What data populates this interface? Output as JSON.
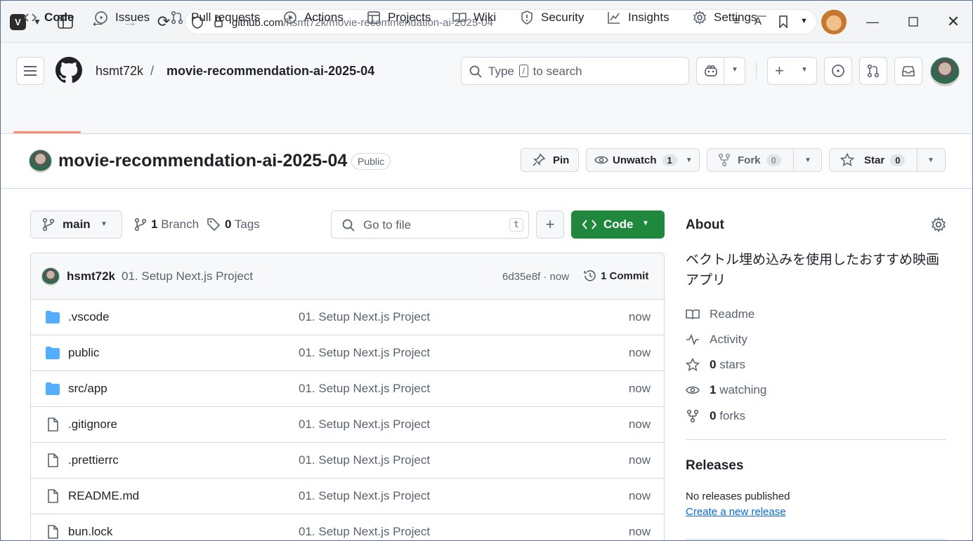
{
  "browser": {
    "url_host": "github.com",
    "url_path": "/hsmt72k/movie-recommendation-ai-2025-04"
  },
  "header": {
    "owner": "hsmt72k",
    "separator": "/",
    "repo": "movie-recommendation-ai-2025-04",
    "search_prefix": "Type",
    "search_key": "/",
    "search_suffix": "to search"
  },
  "nav": {
    "tabs": [
      {
        "label": "Code"
      },
      {
        "label": "Issues"
      },
      {
        "label": "Pull requests"
      },
      {
        "label": "Actions"
      },
      {
        "label": "Projects"
      },
      {
        "label": "Wiki"
      },
      {
        "label": "Security"
      },
      {
        "label": "Insights"
      },
      {
        "label": "Settings"
      }
    ]
  },
  "repo": {
    "name": "movie-recommendation-ai-2025-04",
    "visibility": "Public",
    "pin_label": "Pin",
    "unwatch_label": "Unwatch",
    "watch_count": "1",
    "fork_label": "Fork",
    "fork_count": "0",
    "star_label": "Star",
    "star_count": "0"
  },
  "toolbar": {
    "branch": "main",
    "branch_count": "1",
    "branch_label": "Branch",
    "tag_count": "0",
    "tag_label": "Tags",
    "goto_placeholder": "Go to file",
    "goto_key": "t",
    "code_label": "Code"
  },
  "commit": {
    "author": "hsmt72k",
    "message": "01. Setup Next.js Project",
    "hash_time": "6d35e8f · now",
    "commits_count": "1",
    "commits_label": "Commit"
  },
  "files": [
    {
      "name": ".vscode",
      "type": "folder",
      "message": "01. Setup Next.js Project",
      "time": "now"
    },
    {
      "name": "public",
      "type": "folder",
      "message": "01. Setup Next.js Project",
      "time": "now"
    },
    {
      "name": "src/app",
      "type": "folder",
      "message": "01. Setup Next.js Project",
      "time": "now"
    },
    {
      "name": ".gitignore",
      "type": "file",
      "message": "01. Setup Next.js Project",
      "time": "now"
    },
    {
      "name": ".prettierrc",
      "type": "file",
      "message": "01. Setup Next.js Project",
      "time": "now"
    },
    {
      "name": "README.md",
      "type": "file",
      "message": "01. Setup Next.js Project",
      "time": "now"
    },
    {
      "name": "bun.lock",
      "type": "file",
      "message": "01. Setup Next.js Project",
      "time": "now"
    }
  ],
  "about": {
    "title": "About",
    "description": "ベクトル埋め込みを使用したおすすめ映画アプリ",
    "readme": "Readme",
    "activity": "Activity",
    "stars_count": "0",
    "stars_label": "stars",
    "watching_count": "1",
    "watching_label": "watching",
    "forks_count": "0",
    "forks_label": "forks"
  },
  "releases": {
    "title": "Releases",
    "none": "No releases published",
    "create_link": "Create a new release"
  },
  "colors": {
    "accent_green": "#1f883d",
    "tab_underline": "#fd8c73",
    "folder_blue": "#54aeff",
    "link_blue": "#0969da"
  }
}
